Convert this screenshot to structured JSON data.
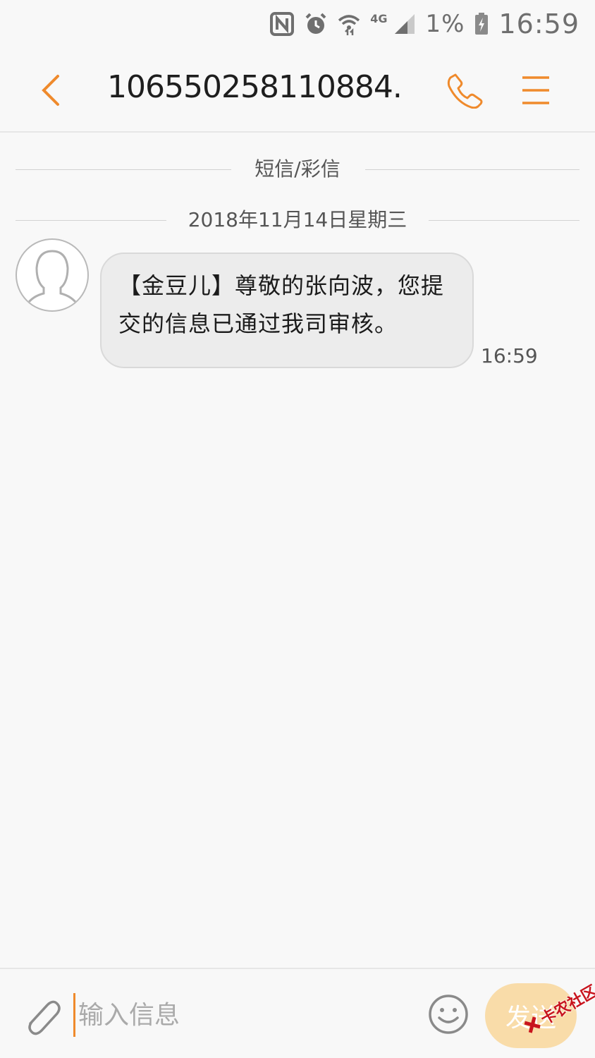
{
  "status_bar": {
    "network_label": "4G",
    "battery_percent": "1%",
    "time": "16:59",
    "icons": [
      "nfc-icon",
      "alarm-icon",
      "wifi-icon",
      "signal-icon",
      "battery-icon"
    ]
  },
  "header": {
    "title": "10655025811088​4...",
    "accent_color": "#ef8a2c"
  },
  "conversation": {
    "type_divider": "短信/彩信",
    "date_divider": "2018年11月14日星期三",
    "messages": [
      {
        "text": "【金豆儿】尊敬的张向波，您提交的信息已通过我司审核。",
        "time": "16:59"
      }
    ]
  },
  "composer": {
    "placeholder": "输入信息",
    "send_label": "发送",
    "send_color": "#f9dca9"
  },
  "watermark": {
    "text": "卡农社区"
  }
}
